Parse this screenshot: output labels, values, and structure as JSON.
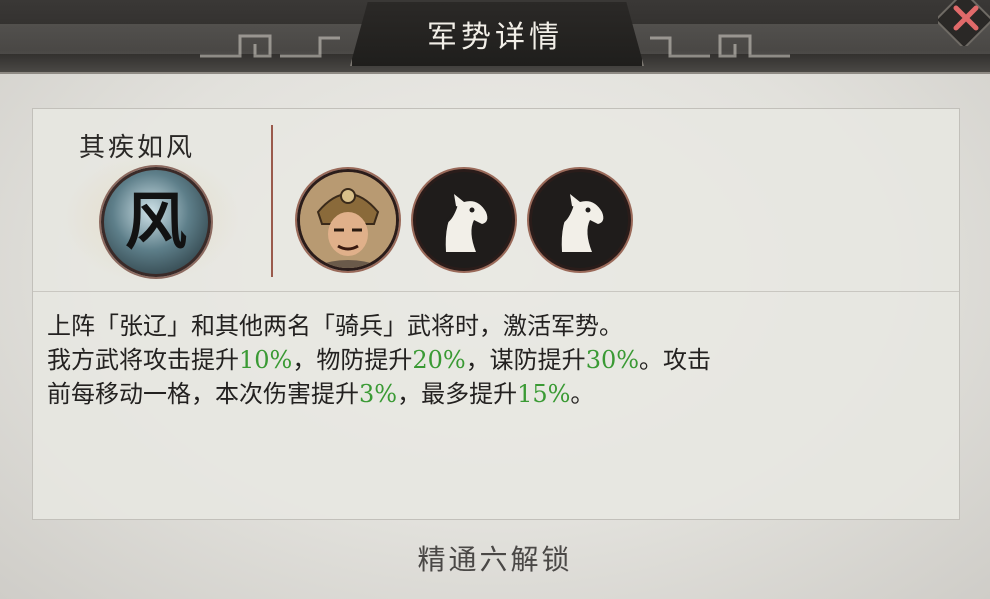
{
  "header": {
    "title": "军势详情"
  },
  "close_button": {
    "icon": "close-x-icon",
    "color": "#e06a6a"
  },
  "skill": {
    "name": "其疾如风",
    "emblem_glyph": "风",
    "emblem_icon": "wind-emblem-icon"
  },
  "units": [
    {
      "kind": "portrait",
      "icon": "general-portrait-zhang-liao"
    },
    {
      "kind": "cavalry",
      "icon": "horse-head-icon"
    },
    {
      "kind": "cavalry",
      "icon": "horse-head-icon"
    }
  ],
  "description": {
    "line1": "上阵「张辽」和其他两名「骑兵」武将时，激活军势。",
    "line2": {
      "t1": "我方武将攻击提升",
      "v1": "10%",
      "t2": "，物防提升",
      "v2": "20%",
      "t3": "，谋防提升",
      "v3": "30%",
      "t4": "。攻击"
    },
    "line3": {
      "t1": "前每移动一格，本次伤害提升",
      "v1": "3%",
      "t2": "，最多提升",
      "v2": "15%",
      "t3": "。"
    },
    "highlight_color": "#3a9a34"
  },
  "footer": {
    "unlock_text": "精通六解锁"
  }
}
